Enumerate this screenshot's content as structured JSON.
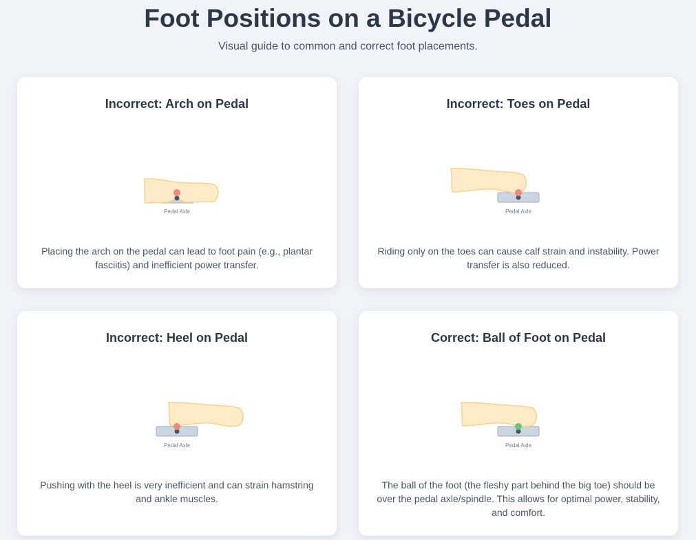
{
  "header": {
    "title": "Foot Positions on a Bicycle Pedal",
    "subtitle": "Visual guide to common and correct foot placements."
  },
  "colors": {
    "incorrect_dot": "#f08a7a",
    "correct_dot": "#68c47c",
    "axle": "#4a5568",
    "foot": "#feebc8",
    "pedal": "#cbd5e0"
  },
  "cards": [
    {
      "title": "Incorrect: Arch on Pedal",
      "axle_label": "Pedal Axle",
      "description": "Placing the arch on the pedal can lead to foot pain (e.g., plantar fasciitis) and inefficient power transfer."
    },
    {
      "title": "Incorrect: Toes on Pedal",
      "axle_label": "Pedal Axle",
      "description": "Riding only on the toes can cause calf strain and instability. Power transfer is also reduced."
    },
    {
      "title": "Incorrect: Heel on Pedal",
      "axle_label": "Pedal Axle",
      "description": "Pushing with the heel is very inefficient and can strain hamstring and ankle muscles."
    },
    {
      "title": "Correct: Ball of Foot on Pedal",
      "axle_label": "Pedal Axle",
      "description": "The ball of the foot (the fleshy part behind the big toe) should be over the pedal axle/spindle. This allows for optimal power, stability, and comfort."
    }
  ]
}
